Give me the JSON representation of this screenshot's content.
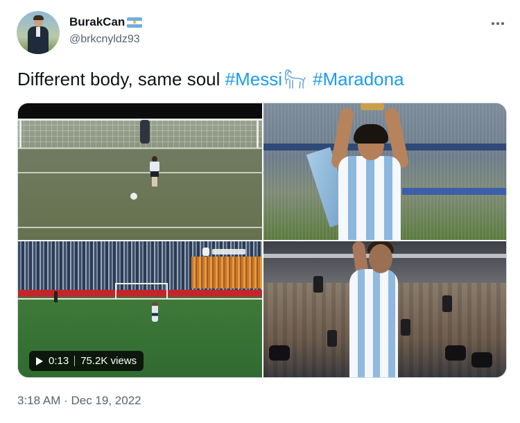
{
  "author": {
    "name": "BurakCan",
    "handle": "@brkcnyldz93",
    "name_flag": "argentina-flag"
  },
  "tweet": {
    "text": "Different body, same soul",
    "hashtags": [
      "#Messi",
      "#Maradona"
    ],
    "emoji": "goat"
  },
  "media": {
    "video": {
      "duration": "0:13",
      "views": "75.2K views"
    }
  },
  "timestamp": "3:18 AM · Dec 19, 2022",
  "colors": {
    "link": "#1d9bf0",
    "secondary_text": "#536471",
    "primary_text": "#0f1419"
  }
}
